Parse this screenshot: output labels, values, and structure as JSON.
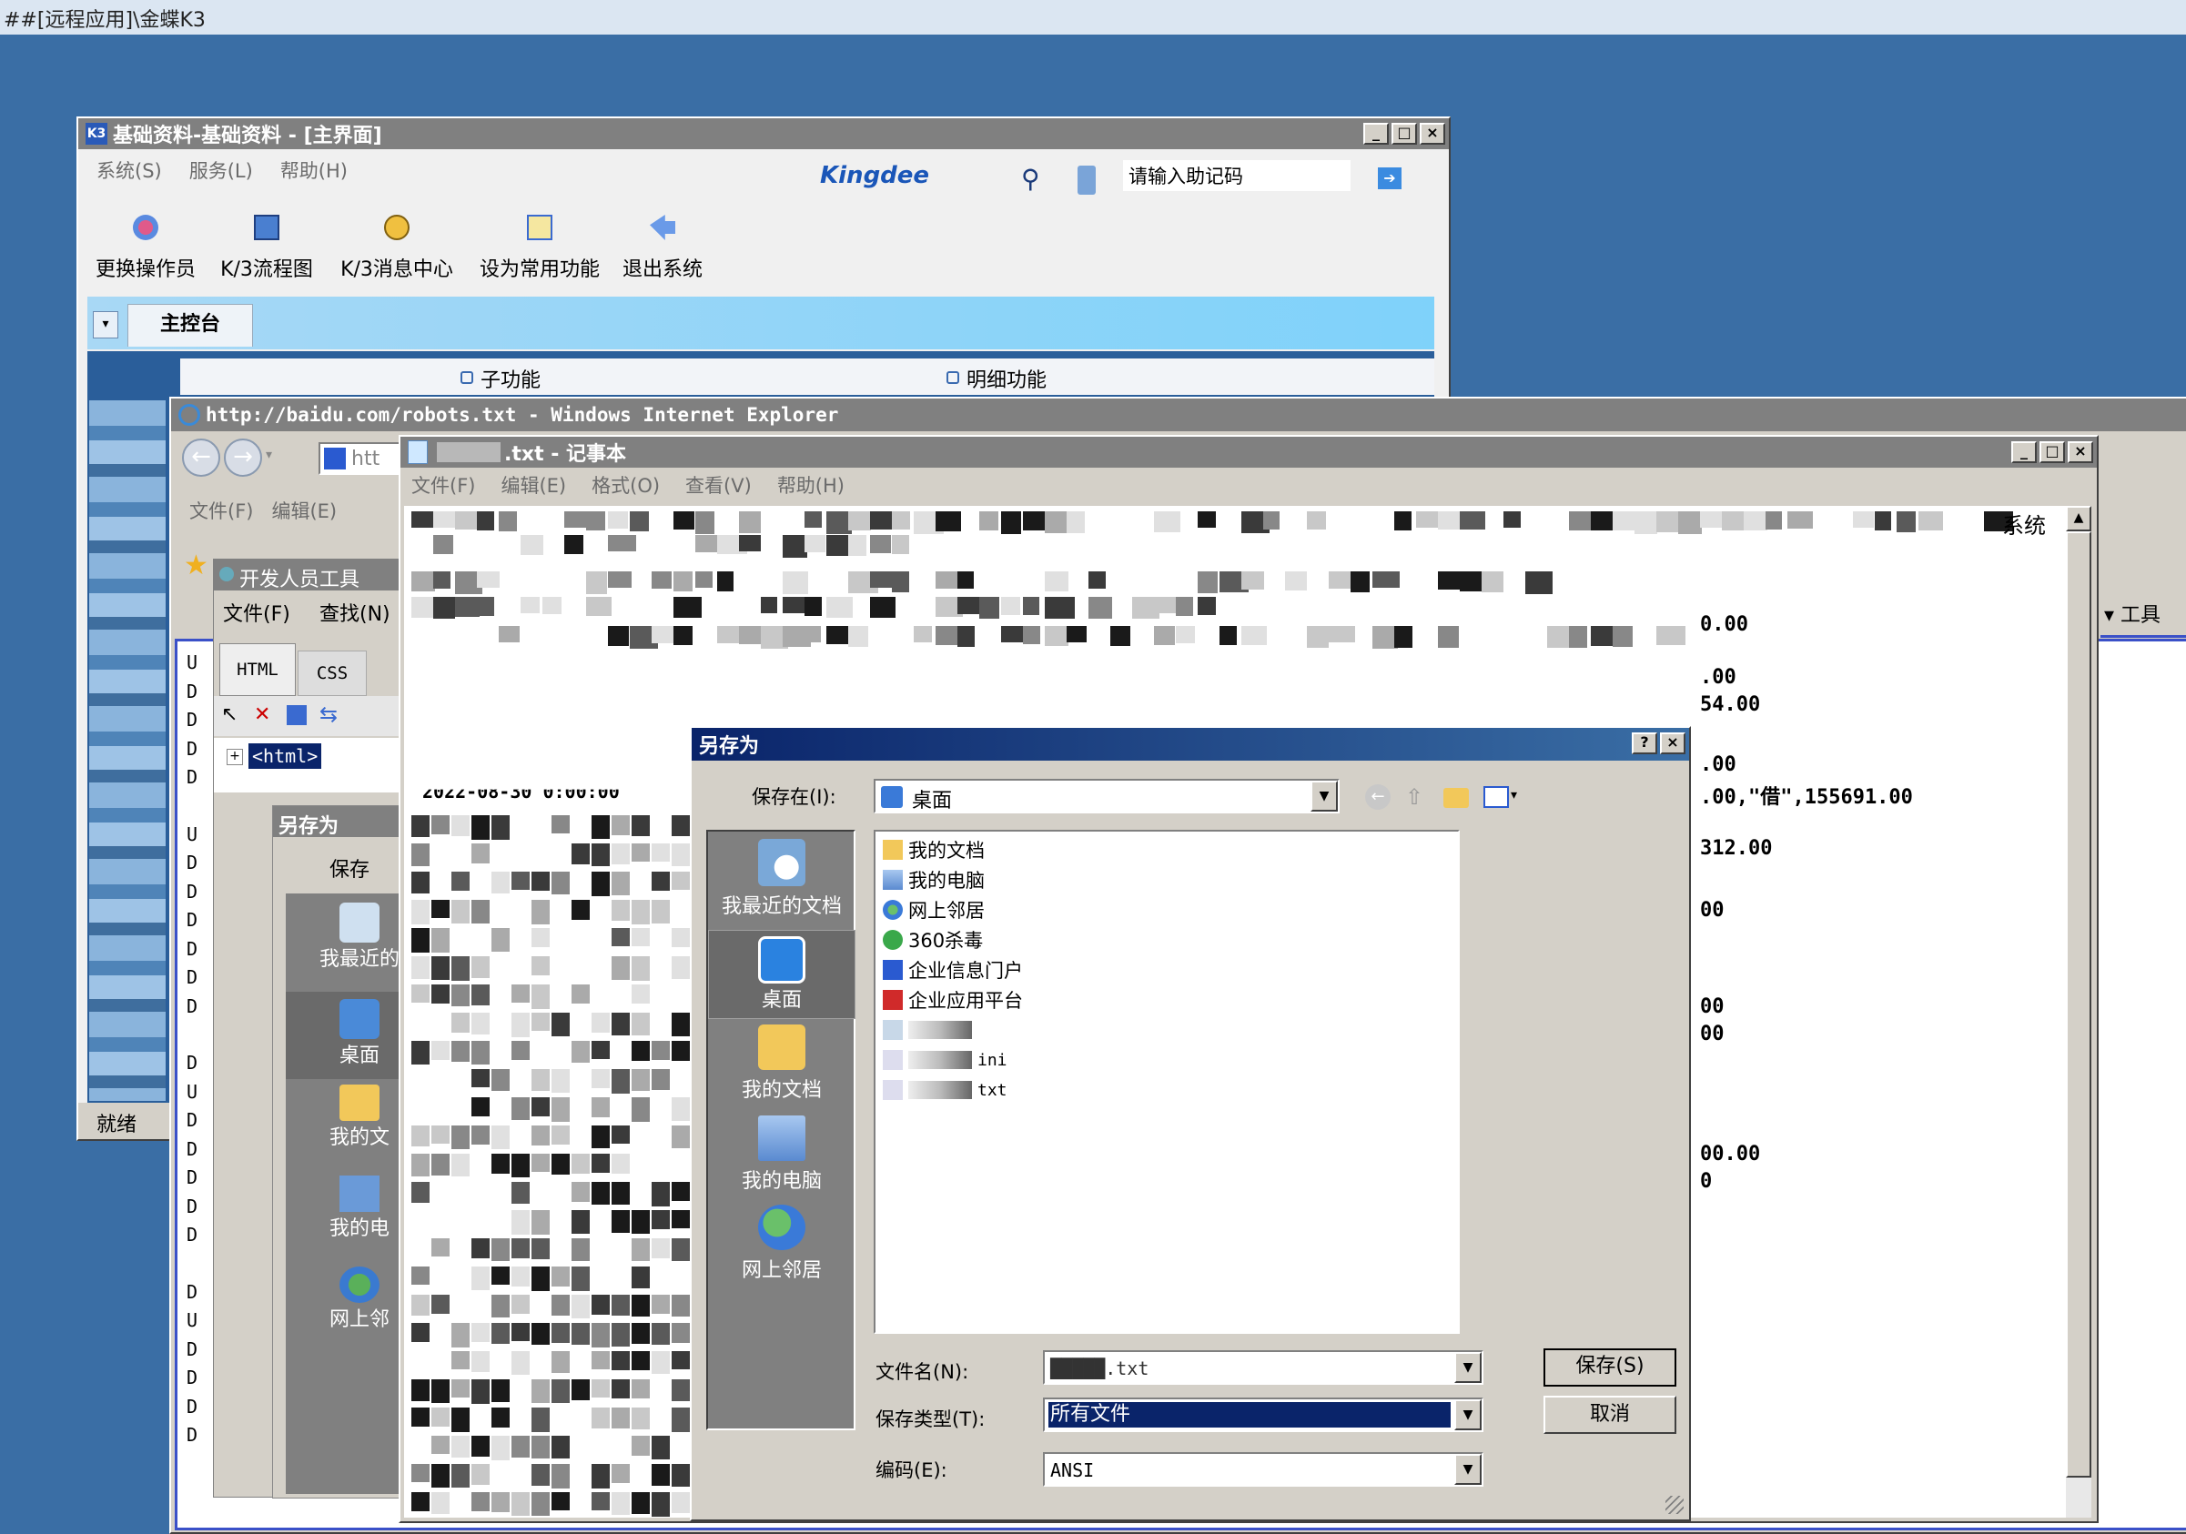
{
  "desktop": {
    "title": "##[远程应用]\\金蝶K3"
  },
  "k3": {
    "title": "基础资料-基础资料 - [主界面]",
    "menu": [
      "系统(S)",
      "服务(L)",
      "帮助(H)"
    ],
    "brand": "Kingdee",
    "search_placeholder": "请输入助记码",
    "toolbar": [
      "更换操作员",
      "K/3流程图",
      "K/3消息中心",
      "设为常用功能",
      "退出系统"
    ],
    "tab": "主控台",
    "sub_function": "子功能",
    "detail_function": "明细功能",
    "status": "就绪"
  },
  "ie": {
    "title": "http://baidu.com/robots.txt - Windows Internet Explorer",
    "address_fragment": "htt",
    "menu": [
      "文件(F)",
      "编辑(E)"
    ],
    "tools": "工具",
    "devtools": {
      "title": "开发人员工具",
      "menu": [
        "文件(F)",
        "查找(N)"
      ],
      "tabs": [
        "HTML",
        "CSS"
      ],
      "tree_node": "<html>"
    },
    "ghost_dialog": {
      "title": "另存为",
      "save_in": "保存",
      "places": [
        "我最近的",
        "桌面",
        "我的文",
        "我的电",
        "网上邻"
      ]
    },
    "left_letters": [
      "U",
      "D",
      "D",
      "D",
      "D",
      "U",
      "D",
      "D",
      "D",
      "D",
      "D",
      "D",
      "D",
      "U",
      "D",
      "D",
      "D",
      "D",
      "D",
      "D",
      "U",
      "D",
      "D",
      "D",
      "D"
    ]
  },
  "notepad": {
    "title": ".txt - 记事本",
    "menu": [
      "文件(F)",
      "编辑(E)",
      "格式(O)",
      "查看(V)",
      "帮助(H)"
    ],
    "top_right_text": "系统",
    "partial_line": "2022-08-30 0:00:00",
    "right_lines": [
      "0.00",
      ".00",
      "54.00",
      ".00",
      ".00,\"借\",155691.00",
      "312.00",
      "00",
      "00",
      "00",
      "00.00",
      "0"
    ]
  },
  "saveas": {
    "title": "另存为",
    "save_in_label": "保存在(I):",
    "save_in_value": "桌面",
    "places": [
      "我最近的文档",
      "桌面",
      "我的文档",
      "我的电脑",
      "网上邻居"
    ],
    "files": [
      {
        "name": "我的文档",
        "icon": "folder-docs-icon"
      },
      {
        "name": "我的电脑",
        "icon": "computer-icon"
      },
      {
        "name": "网上邻居",
        "icon": "network-icon"
      },
      {
        "name": "360杀毒",
        "icon": "antivirus-icon"
      },
      {
        "name": "企业信息门户",
        "icon": "portal-icon"
      },
      {
        "name": "企业应用平台",
        "icon": "platform-icon"
      },
      {
        "name": "",
        "icon": "file-icon"
      },
      {
        "name": "ini",
        "icon": "ini-file-icon"
      },
      {
        "name": "txt",
        "icon": "txt-file-icon"
      }
    ],
    "filename_label": "文件名(N):",
    "filename_value": "█████.txt",
    "savetype_label": "保存类型(T):",
    "savetype_value": "所有文件",
    "encoding_label": "编码(E):",
    "encoding_value": "ANSI",
    "save_button": "保存(S)",
    "cancel_button": "取消",
    "help_button": "?",
    "close_button": "×"
  }
}
